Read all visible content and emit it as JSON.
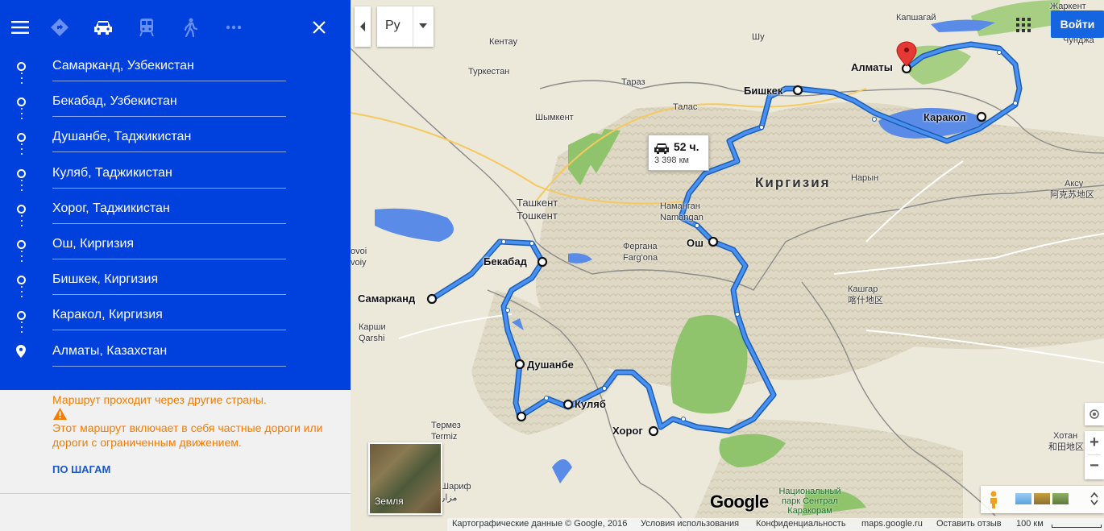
{
  "panel": {
    "modes": [
      {
        "icon": "menu-icon"
      },
      {
        "icon": "directions-icon"
      },
      {
        "icon": "car-icon"
      },
      {
        "icon": "transit-icon"
      },
      {
        "icon": "walk-icon"
      },
      {
        "icon": "more-icon"
      },
      {
        "icon": "close-icon"
      }
    ],
    "stops": [
      "Самарканд, Узбекистан",
      "Бекабад, Узбекистан",
      "Душанбе, Таджикистан",
      "Куляб, Таджикистан",
      "Хорог, Таджикистан",
      "Ош, Киргизия",
      "Бишкек, Киргизия",
      "Каракол, Киргизия",
      "Алматы, Казахстан"
    ],
    "warning_countries": "Маршрут проходит через другие страны.",
    "warning_private": "Этот маршрут включает в себя частные дороги или дороги с ограниченным движением.",
    "steps_link": "ПО ШАГАМ"
  },
  "map": {
    "lang_label": "Ру",
    "signin_label": "Войти",
    "route_time": "52 ч.",
    "route_distance": "3 398 км",
    "earth_label": "Земля",
    "country_label": "Киргизия",
    "cities": {
      "samarkand": "Самарканд",
      "bekabad": "Бекабад",
      "dushanbe": "Душанбе",
      "kulyab": "Куляб",
      "khorog": "Хорог",
      "osh": "Ош",
      "bishkek": "Бишкек",
      "karakol": "Каракол",
      "almaty": "Алматы"
    },
    "places": {
      "kentau": "Кентау",
      "turkestan": "Туркестан",
      "taraz": "Тараз",
      "talas": "Талас",
      "shymkent": "Шымкент",
      "tashkent1": "Ташкент",
      "tashkent2": "Тошкент",
      "namangan1": "Наманган",
      "namangan2": "Namangan",
      "fergana1": "Фергана",
      "fergana2": "Farg'ona",
      "karshi1": "Карши",
      "karshi2": "Qarshi",
      "termez1": "Термез",
      "termez2": "Termiz",
      "sharif1": "Шариф",
      "sharif2": "مزار",
      "naryn": "Нарын",
      "kashgar1": "Кашгар",
      "kashgar2": "喀什地区",
      "aksu1": "Аксу",
      "aksu2": "阿克苏地区",
      "hotan1": "Хотан",
      "hotan2": "和田地区",
      "kapshagai": "Капшагай",
      "zharkent": "Жаркент",
      "chundzha": "Чунджа",
      "shu": "Шу",
      "voij1": "ovoi",
      "voij2": "voiy",
      "park": "Национальный парк Сентрал Каракорам"
    },
    "footer": {
      "copyright": "Картографические данные © Google, 2016",
      "terms": "Условия использования",
      "privacy": "Конфиденциальность",
      "site": "maps.google.ru",
      "feedback": "Оставить отзыв",
      "scale": "100 км"
    },
    "google_logo": "Google",
    "colors": {
      "panel": "#0040dd",
      "route": "#2979e6",
      "warning": "#f57c00",
      "link": "#1a56c8"
    }
  }
}
